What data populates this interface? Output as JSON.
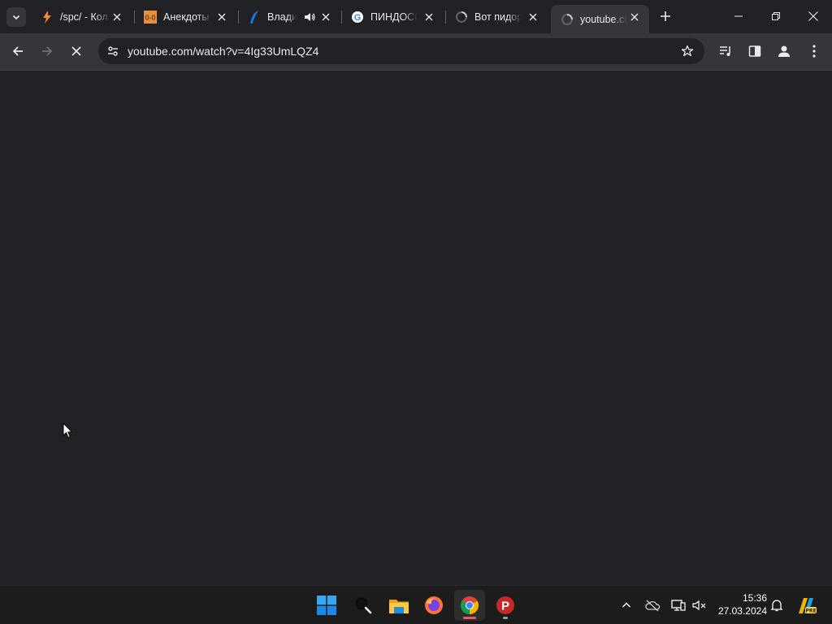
{
  "browser": {
    "tabs": [
      {
        "title": "/spc/ - Кол",
        "favicon": "lightning-icon",
        "active": false
      },
      {
        "title": "Анекдоты",
        "favicon": "oo-logo-icon",
        "active": false
      },
      {
        "title": "Владими",
        "favicon": "blue-feather-icon",
        "active": false,
        "audio": true
      },
      {
        "title": "ПИНДОСС",
        "favicon": "google-g-icon",
        "active": false
      },
      {
        "title": "Вот пидор",
        "favicon": "loading-spinner-icon",
        "active": false
      },
      {
        "title": "youtube.co",
        "favicon": "loading-spinner-icon",
        "active": true
      }
    ],
    "address_bar": {
      "url": "youtube.com/watch?v=4Ig33UmLQZ4"
    }
  },
  "taskbar": {
    "apps": [
      {
        "name": "start-button",
        "icon": "windows-logo-icon"
      },
      {
        "name": "search",
        "icon": "search-icon"
      },
      {
        "name": "file-explorer",
        "icon": "folder-icon"
      },
      {
        "name": "firefox",
        "icon": "firefox-icon"
      },
      {
        "name": "chrome",
        "icon": "chrome-icon",
        "active": true
      },
      {
        "name": "psiphon",
        "icon": "psiphon-icon",
        "running": true
      }
    ],
    "clock": {
      "time": "15:36",
      "date": "27.03.2024"
    },
    "tray": {
      "copilot_badge": "PRE"
    }
  },
  "colors": {
    "accent_chrome_indicator": "#ec5b5b",
    "content_background": "#202124",
    "toolbar_background": "#35363a"
  }
}
